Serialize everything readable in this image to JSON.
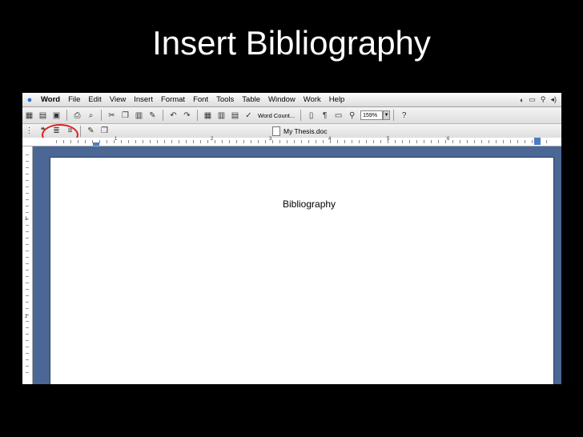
{
  "slide": {
    "title": "Insert Bibliography"
  },
  "menubar": {
    "apple_icon": "",
    "items": [
      "Word",
      "File",
      "Edit",
      "View",
      "Insert",
      "Format",
      "Font",
      "Tools",
      "Table",
      "Window",
      "Work",
      "Help"
    ],
    "tray": [
      "◐",
      "▭",
      "⚲",
      "◂)"
    ]
  },
  "toolbar": {
    "word_count_label": "Word Count...",
    "paragraph_label": "¶",
    "zoom_value": "159%",
    "help_label": "?"
  },
  "document": {
    "filename": "My Thesis.doc",
    "body_text": "Bibliography"
  },
  "ruler": {
    "marks": [
      "1",
      "2",
      "3",
      "4",
      "5",
      "6"
    ]
  },
  "vruler": {
    "marks": [
      "1",
      "2"
    ]
  },
  "highlight": {
    "color": "#e21f1f"
  }
}
